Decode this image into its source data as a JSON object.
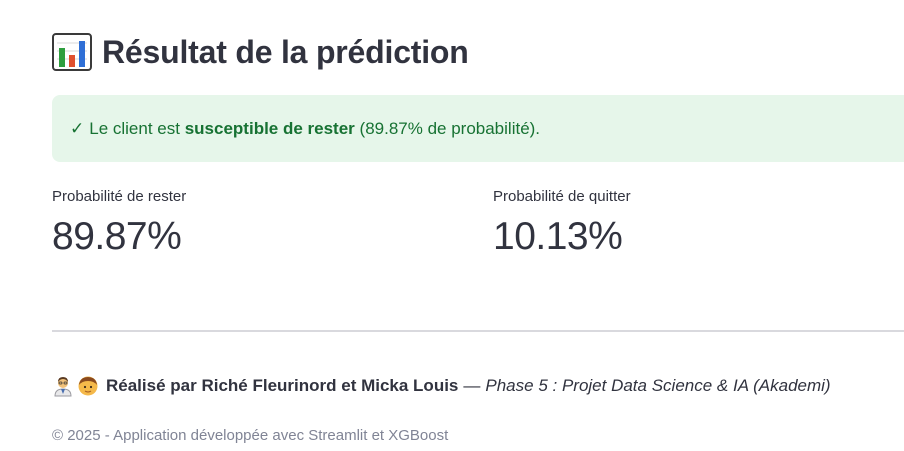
{
  "header": {
    "icon": "bar-chart-icon",
    "title": "Résultat de la prédiction"
  },
  "alert": {
    "icon": "check-icon",
    "check": "✓",
    "text_before": "Le client est",
    "text_strong": "susceptible de rester",
    "text_after": "(89.87% de probabilité).",
    "colors": {
      "background": "#e6f6ea",
      "text": "#177233"
    }
  },
  "metrics": [
    {
      "label": "Probabilité de rester",
      "value": "89.87%"
    },
    {
      "label": "Probabilité de quitter",
      "value": "10.13%"
    }
  ],
  "footer": {
    "icons": [
      "scientist-icon",
      "person-icon"
    ],
    "credits_strong": "Réalisé par Riché Fleurinord et Micka Louis",
    "separator": "—",
    "credits_em": "Phase 5 : Projet Data Science & IA (Akademi)",
    "copyright": "© 2025 - Application développée avec Streamlit et XGBoost"
  }
}
